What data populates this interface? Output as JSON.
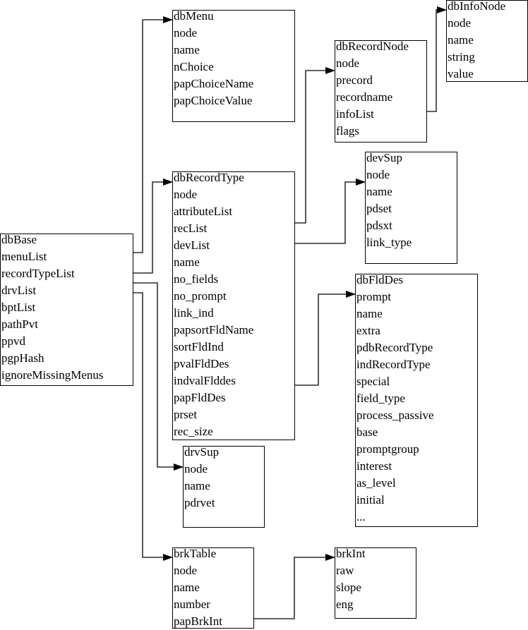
{
  "diagram": {
    "structs": [
      {
        "id": "dbBase",
        "title": "dbBase",
        "fields": [
          "menuList",
          "recordTypeList",
          "drvList",
          "bptList",
          "pathPvt",
          "ppvd",
          "pgpHash",
          "ignoreMissingMenus"
        ]
      },
      {
        "id": "dbMenu",
        "title": "dbMenu",
        "fields": [
          "node",
          "name",
          "nChoice",
          "papChoiceName",
          "papChoiceValue"
        ]
      },
      {
        "id": "dbRecordType",
        "title": "dbRecordType",
        "fields": [
          "node",
          "attributeList",
          "recList",
          "devList",
          "name",
          "no_fields",
          "no_prompt",
          "link_ind",
          "papsortFldName",
          "sortFldInd",
          "pvalFldDes",
          "indvalFlddes",
          "papFldDes",
          "prset",
          "rec_size"
        ]
      },
      {
        "id": "dbRecordNode",
        "title": "dbRecordNode",
        "fields": [
          "node",
          "precord",
          "recordname",
          "infoList",
          "flags"
        ]
      },
      {
        "id": "dbInfoNode",
        "title": "dbInfoNode",
        "fields": [
          "node",
          "name",
          "string",
          "value"
        ]
      },
      {
        "id": "devSup",
        "title": "devSup",
        "fields": [
          "node",
          "name",
          "pdset",
          "pdsxt",
          "link_type"
        ]
      },
      {
        "id": "dbFldDes",
        "title": "dbFldDes",
        "fields": [
          "prompt",
          "name",
          "extra",
          "pdbRecordType",
          "indRecordType",
          "special",
          "field_type",
          "process_passive",
          "base",
          "promptgroup",
          "interest",
          "as_level",
          "initial",
          "..."
        ]
      },
      {
        "id": "drvSup",
        "title": "drvSup",
        "fields": [
          "node",
          "name",
          "pdrvet"
        ]
      },
      {
        "id": "brkTable",
        "title": "brkTable",
        "fields": [
          "node",
          "name",
          "number",
          "papBrkInt"
        ]
      },
      {
        "id": "brkInt",
        "title": "brkInt",
        "fields": [
          "raw",
          "slope",
          "eng"
        ]
      }
    ],
    "links": [
      {
        "from": "dbBase.menuList",
        "to": "dbMenu"
      },
      {
        "from": "dbBase.recordTypeList",
        "to": "dbRecordType"
      },
      {
        "from": "dbBase.drvList",
        "to": "drvSup"
      },
      {
        "from": "dbBase.bptList",
        "to": "brkTable"
      },
      {
        "from": "dbRecordType.recList",
        "to": "dbRecordNode"
      },
      {
        "from": "dbRecordType.devList",
        "to": "devSup"
      },
      {
        "from": "dbRecordType.indvalFlddes",
        "to": "dbFldDes"
      },
      {
        "from": "dbRecordNode.infoList",
        "to": "dbInfoNode"
      },
      {
        "from": "brkTable.papBrkInt",
        "to": "brkInt"
      }
    ],
    "colors": {
      "line": "#000000",
      "background": "#ffffff",
      "text": "#000000"
    }
  }
}
